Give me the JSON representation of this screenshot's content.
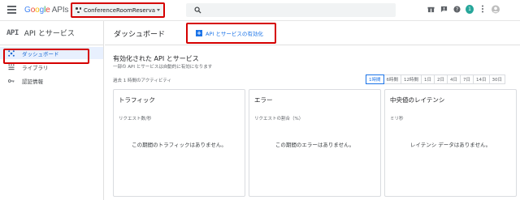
{
  "topbar": {
    "logo_google": "Google",
    "logo_apis": "APIs",
    "project_name": "ConferenceRoomReserva...",
    "search_placeholder": "",
    "avatar_letter": "1"
  },
  "sidebar": {
    "api_logo": "API",
    "title": "API とサービス",
    "items": [
      {
        "label": "ダッシュボード",
        "icon": "dashboard-icon",
        "active": true
      },
      {
        "label": "ライブラリ",
        "icon": "library-icon",
        "active": false
      },
      {
        "label": "認証情報",
        "icon": "key-icon",
        "active": false
      }
    ]
  },
  "main": {
    "title": "ダッシュボード",
    "enable_button": "API とサービスの有効化",
    "section_title": "有効化された API とサービス",
    "section_subtitle": "一部の API とサービスは自動的に有効になります",
    "activity_label": "過去 1 時間のアクティビティ",
    "ranges": [
      "1時間",
      "6時間",
      "12時間",
      "1日",
      "2日",
      "4日",
      "7日",
      "14日",
      "30日"
    ],
    "active_range": "1時間",
    "cards": [
      {
        "title": "トラフィック",
        "subtitle": "リクエスト数/秒",
        "empty": "この期間のトラフィックはありません。"
      },
      {
        "title": "エラー",
        "subtitle": "リクエストの割合（%）",
        "empty": "この期間のエラーはありません。"
      },
      {
        "title": "中央値のレイテンシ",
        "subtitle": "ミリ秒",
        "empty": "レイテンシ データはありません。"
      }
    ]
  },
  "colors": {
    "accent": "#1a73e8",
    "highlight_box": "#d50000",
    "active_nav_bg": "#e8f0fe"
  }
}
